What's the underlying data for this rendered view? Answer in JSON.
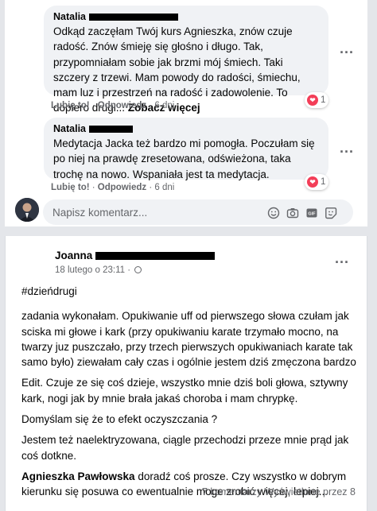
{
  "comments": [
    {
      "author": "Natalia",
      "text": "Odkąd zaczęłam Twój kurs Agnieszka, znów czuje radość. Znów śmieję się głośno i długo. Tak, przypomniałam sobie jak brzmi mój śmiech. Taki szczery z trzewi. Mam powody do radości, śmiechu, mam luz i przestrzeń na radość i zadowolenie. To dopiero drugi...",
      "see_more": "Zobacz więcej",
      "like": "Lubię to!",
      "reply": "Odpowiedz",
      "time": "6 dni",
      "reactions": "1"
    },
    {
      "author": "Natalia",
      "text": "Medytacja Jacka też bardzo mi pomogła. Poczułam się po niej na prawdę zresetowana, odświeżona, taka trochę na nowo. Wspaniała jest ta medytacja.",
      "like": "Lubię to!",
      "reply": "Odpowiedz",
      "time": "6 dni",
      "reactions": "1"
    }
  ],
  "composer": {
    "placeholder": "Napisz komentarz..."
  },
  "post": {
    "author": "Joanna",
    "date": "18 lutego o 23:11 · ",
    "hashtag": "#dzieńdrugi",
    "paragraphs": [
      "zadania wykonałam. Opukiwanie uff od pierwszego słowa czułam jak sciska mi głowe i kark (przy opukiwaniu karate trzymało mocno, na twarzy juz puszczało, przy trzech pierwszych opukiwaniach karate tak samo było) ziewałam cały czas i ogólnie jestem dziś zmęczona bardzo",
      "Edit. Czuje ze się coś dzieje, wszystko mnie dziś boli głowa, sztywny kark, nogi jak by mnie brała jakaś choroba i mam chrypkę.",
      "Domyślam się że to efekt oczyszczania ?",
      "Jestem też naelektryzowana, ciągle przechodzi przeze mnie prąd jak coś dotkne."
    ],
    "mention": "Agnieszka Pawłowska",
    "last_paragraph": " doradź coś prosze. Czy wszystko w dobrym kierunku się posuwa co ewentualnie moge zrobić więcej, lepiej...",
    "footer": "7 komentarzy  Wyświetlone przez 8"
  },
  "icons": {
    "more": "more-options-icon",
    "heart": "heart-reaction-icon",
    "emoji": "emoji-icon",
    "camera": "camera-icon",
    "gif": "gif-icon",
    "sticker": "sticker-icon",
    "globe": "globe-icon"
  },
  "colors": {
    "heart": "#f33e58",
    "bubble": "#f0f2f5",
    "secondary_text": "#65676b"
  }
}
